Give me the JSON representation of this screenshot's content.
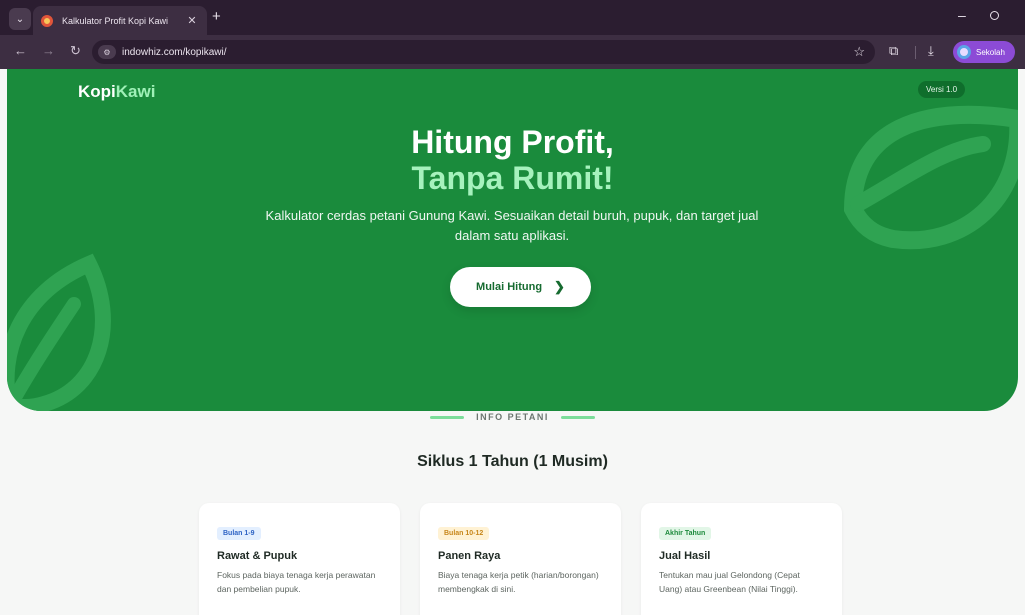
{
  "browser": {
    "tab_title": "Kalkulator Profit Kopi Kawi",
    "url": "indowhiz.com/kopikawi/",
    "profile_label": "Sekolah"
  },
  "hero": {
    "logo_main": "Kopi",
    "logo_accent": "Kawi",
    "version": "Versi 1.0",
    "title_line1": "Hitung Profit,",
    "title_line2": "Tanpa Rumit!",
    "subtitle": "Kalkulator cerdas petani Gunung Kawi. Sesuaikan detail buruh, pupuk, dan target jual dalam satu aplikasi.",
    "cta_label": "Mulai Hitung"
  },
  "info": {
    "eyebrow": "INFO PETANI",
    "section_title": "Siklus 1 Tahun (1 Musim)",
    "cards": [
      {
        "badge": "Bulan 1-9",
        "title": "Rawat & Pupuk",
        "desc": "Fokus pada biaya tenaga kerja perawatan dan pembelian pupuk.",
        "badge_bg": "#e3efff",
        "badge_fg": "#2e63c4"
      },
      {
        "badge": "Bulan 10-12",
        "title": "Panen Raya",
        "desc": "Biaya tenaga kerja petik (harian/borongan) membengkak di sini.",
        "badge_bg": "#fff2d4",
        "badge_fg": "#c7861a"
      },
      {
        "badge": "Akhir Tahun",
        "title": "Jual Hasil",
        "desc": "Tentukan mau jual Gelondong (Cepat Uang) atau Greenbean (Nilai Tinggi).",
        "badge_bg": "#e2f6e7",
        "badge_fg": "#1d8a3c"
      }
    ]
  },
  "colors": {
    "hero_green": "#1a8b3c",
    "accent_mint": "#a6f2bd",
    "browser_frame": "#3d2e42",
    "profile_purple": "#8c4bd6"
  },
  "icons": {
    "tab_menu": "chevron-down-icon",
    "back": "arrow-left-icon",
    "forward": "arrow-right-icon",
    "reload": "reload-icon",
    "bookmark": "star-icon",
    "extensions": "puzzle-icon",
    "download": "download-icon",
    "cta": "chevron-right-icon",
    "decor": "leaf-icon"
  }
}
